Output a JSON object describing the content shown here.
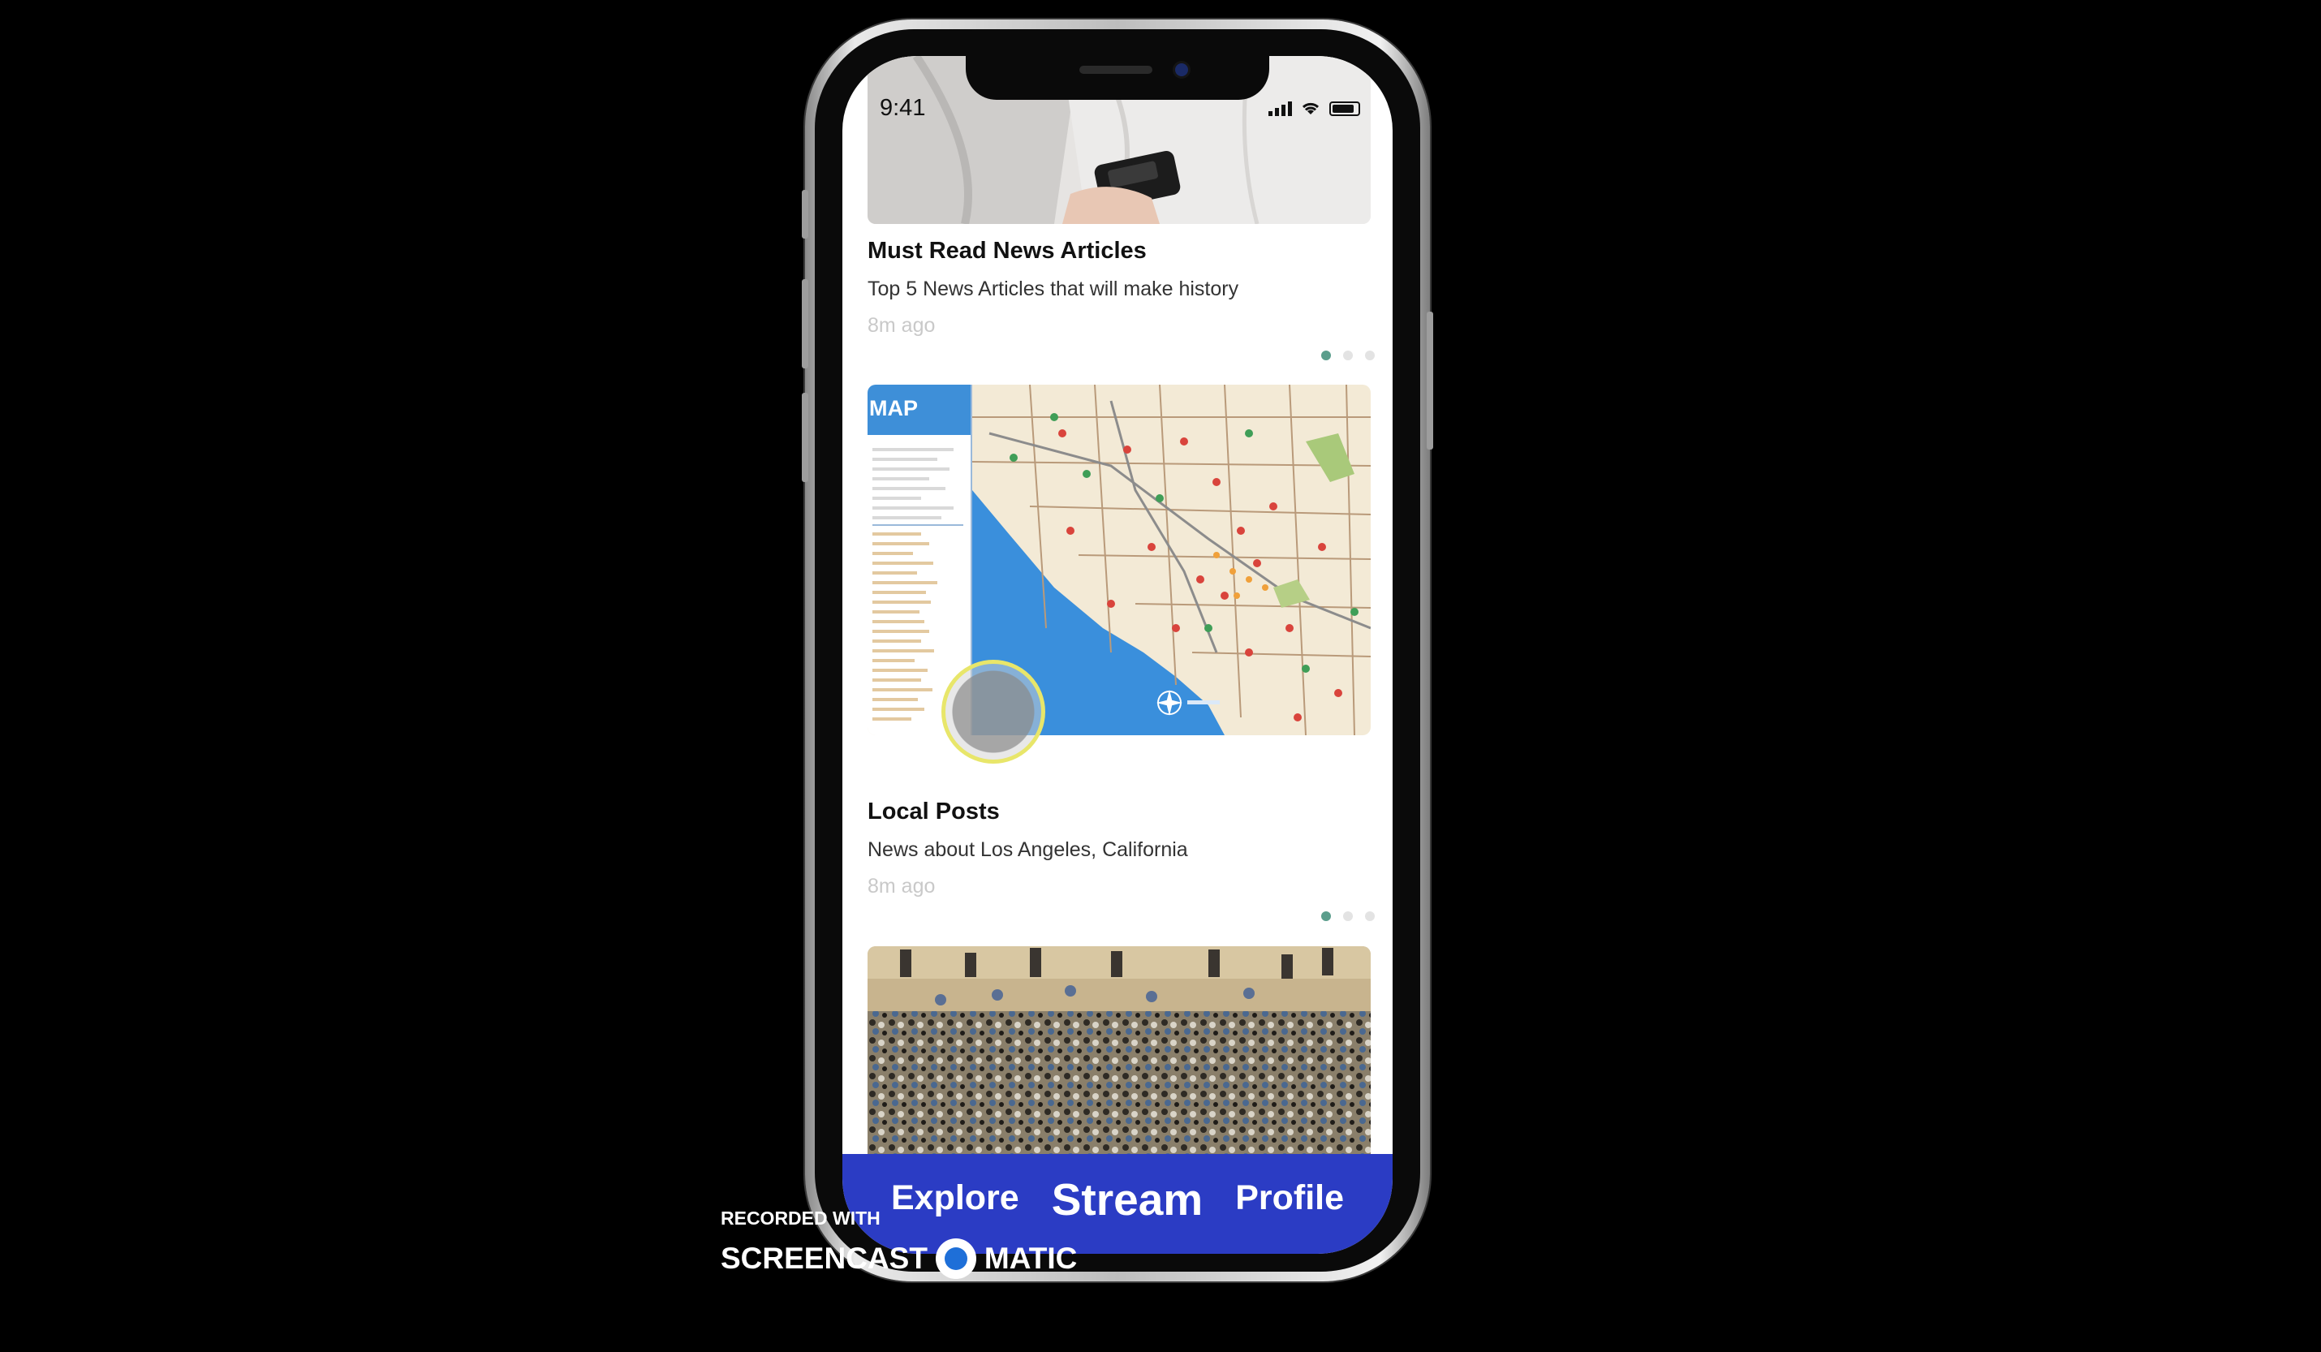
{
  "status_bar": {
    "time": "9:41"
  },
  "feed": {
    "cards": [
      {
        "title": "Must Read News Articles",
        "subtitle": "Top 5 News Articles that will make history",
        "time": "8m ago",
        "image": "person-holding-phone-photo"
      },
      {
        "title": "Local Posts",
        "subtitle": "News about Los Angeles, California",
        "time": "8m ago",
        "image": "los-angeles-map",
        "map_label": "MAP"
      },
      {
        "image": "crowd-protest-photo"
      }
    ],
    "dot_color_active": "#5b9e8c",
    "dot_color_inactive": "#e3e3e3"
  },
  "tabbar": {
    "background": "#2b3cc4",
    "tabs": [
      {
        "label": "Explore",
        "active": false
      },
      {
        "label": "Stream",
        "active": true
      },
      {
        "label": "Profile",
        "active": false
      }
    ]
  },
  "watermark": {
    "line1": "RECORDED WITH",
    "left": "SCREENCAST",
    "right": "MATIC"
  }
}
